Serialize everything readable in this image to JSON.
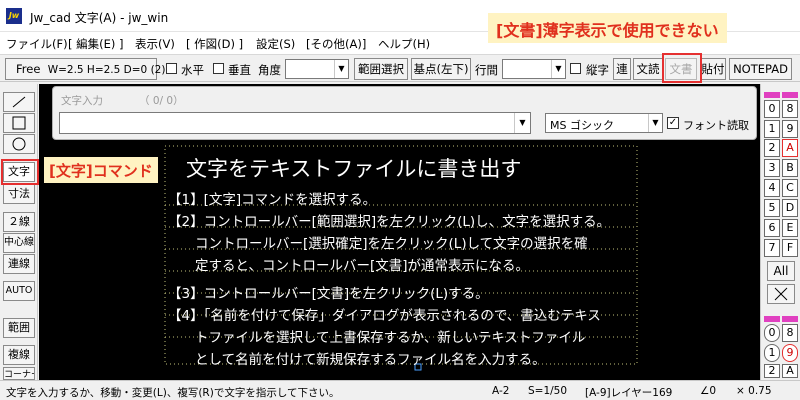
{
  "window": {
    "title": "Jw_cad 文字(A) - jw_win",
    "icon_label": "Jw"
  },
  "menu": [
    "ファイル(F)",
    "[ 編集(E) ]",
    "表示(V)",
    "[ 作図(D) ]",
    "設定(S)",
    "[その他(A)]",
    "ヘルプ(H)"
  ],
  "toolbar": {
    "free": "Free",
    "size": "W=2.5 H=2.5 D=0 (2)",
    "horizontal": "水平",
    "vertical": "垂直",
    "angle": "角度",
    "range_select": "範囲選択",
    "base_point": "基点(左下)",
    "line_spacing": "行間",
    "vertical_write": "縦字",
    "continuous": "連",
    "read_text": "文読",
    "write_text": "文書",
    "paste": "貼付",
    "notepad": "NOTEPAD"
  },
  "text_input": {
    "label": "文字入力",
    "counter": "（ 0/ 0）",
    "font": "MS ゴシック",
    "font_read_label": "フォント読取"
  },
  "left_tools": [
    "文字",
    "寸法",
    "２線",
    "中心線",
    "連線",
    "AUTO",
    "範囲",
    "複線",
    "コーナー"
  ],
  "right_tools": {
    "col1": [
      "0",
      "1",
      "2",
      "3",
      "4",
      "5",
      "6",
      "7"
    ],
    "col2": [
      "8",
      "9",
      "A",
      "B",
      "C",
      "D",
      "E",
      "F"
    ],
    "all": "All",
    "bottom_col1": [
      "0",
      "1",
      "2"
    ],
    "bottom_col2": [
      "8",
      "9",
      "A"
    ]
  },
  "content": {
    "heading": "文字をテキストファイルに書き出す",
    "lines": [
      "【1】[文字]コマンドを選択する。",
      "【2】コントロールバー[範囲選択]を左クリック(L)し、文字を選択する。",
      "　　コントロールバー[選択確定]を左クリック(L)して文字の選択を確",
      "　　定すると、コントロールバー[文書]が通常表示になる。",
      "【3】コントロールバー[文書]を左クリック(L)する。",
      "【4】「名前を付けて保存」ダイアログが表示されるので、書込むテキス",
      "　　トファイルを選択して上書保存するか、新しいテキストファイル",
      "　　として名前を付けて新規保存するファイル名を入力する。"
    ]
  },
  "annotations": {
    "top": "[文書]薄字表示で使用できない",
    "left": "[文字]コマンド"
  },
  "status": {
    "message": "文字を入力するか、移動・変更(L)、複写(R)で文字を指示して下さい。",
    "paper": "A-2",
    "scale": "S=1/50",
    "layer": "[A-9]レイヤー169",
    "angle": "∠0",
    "zoom": "× 0.75"
  },
  "colors": {
    "annotation_text": "#e0301e",
    "annotation_bg": "#fff3c2",
    "highlight_box": "#e53030",
    "canvas": "#000000"
  }
}
